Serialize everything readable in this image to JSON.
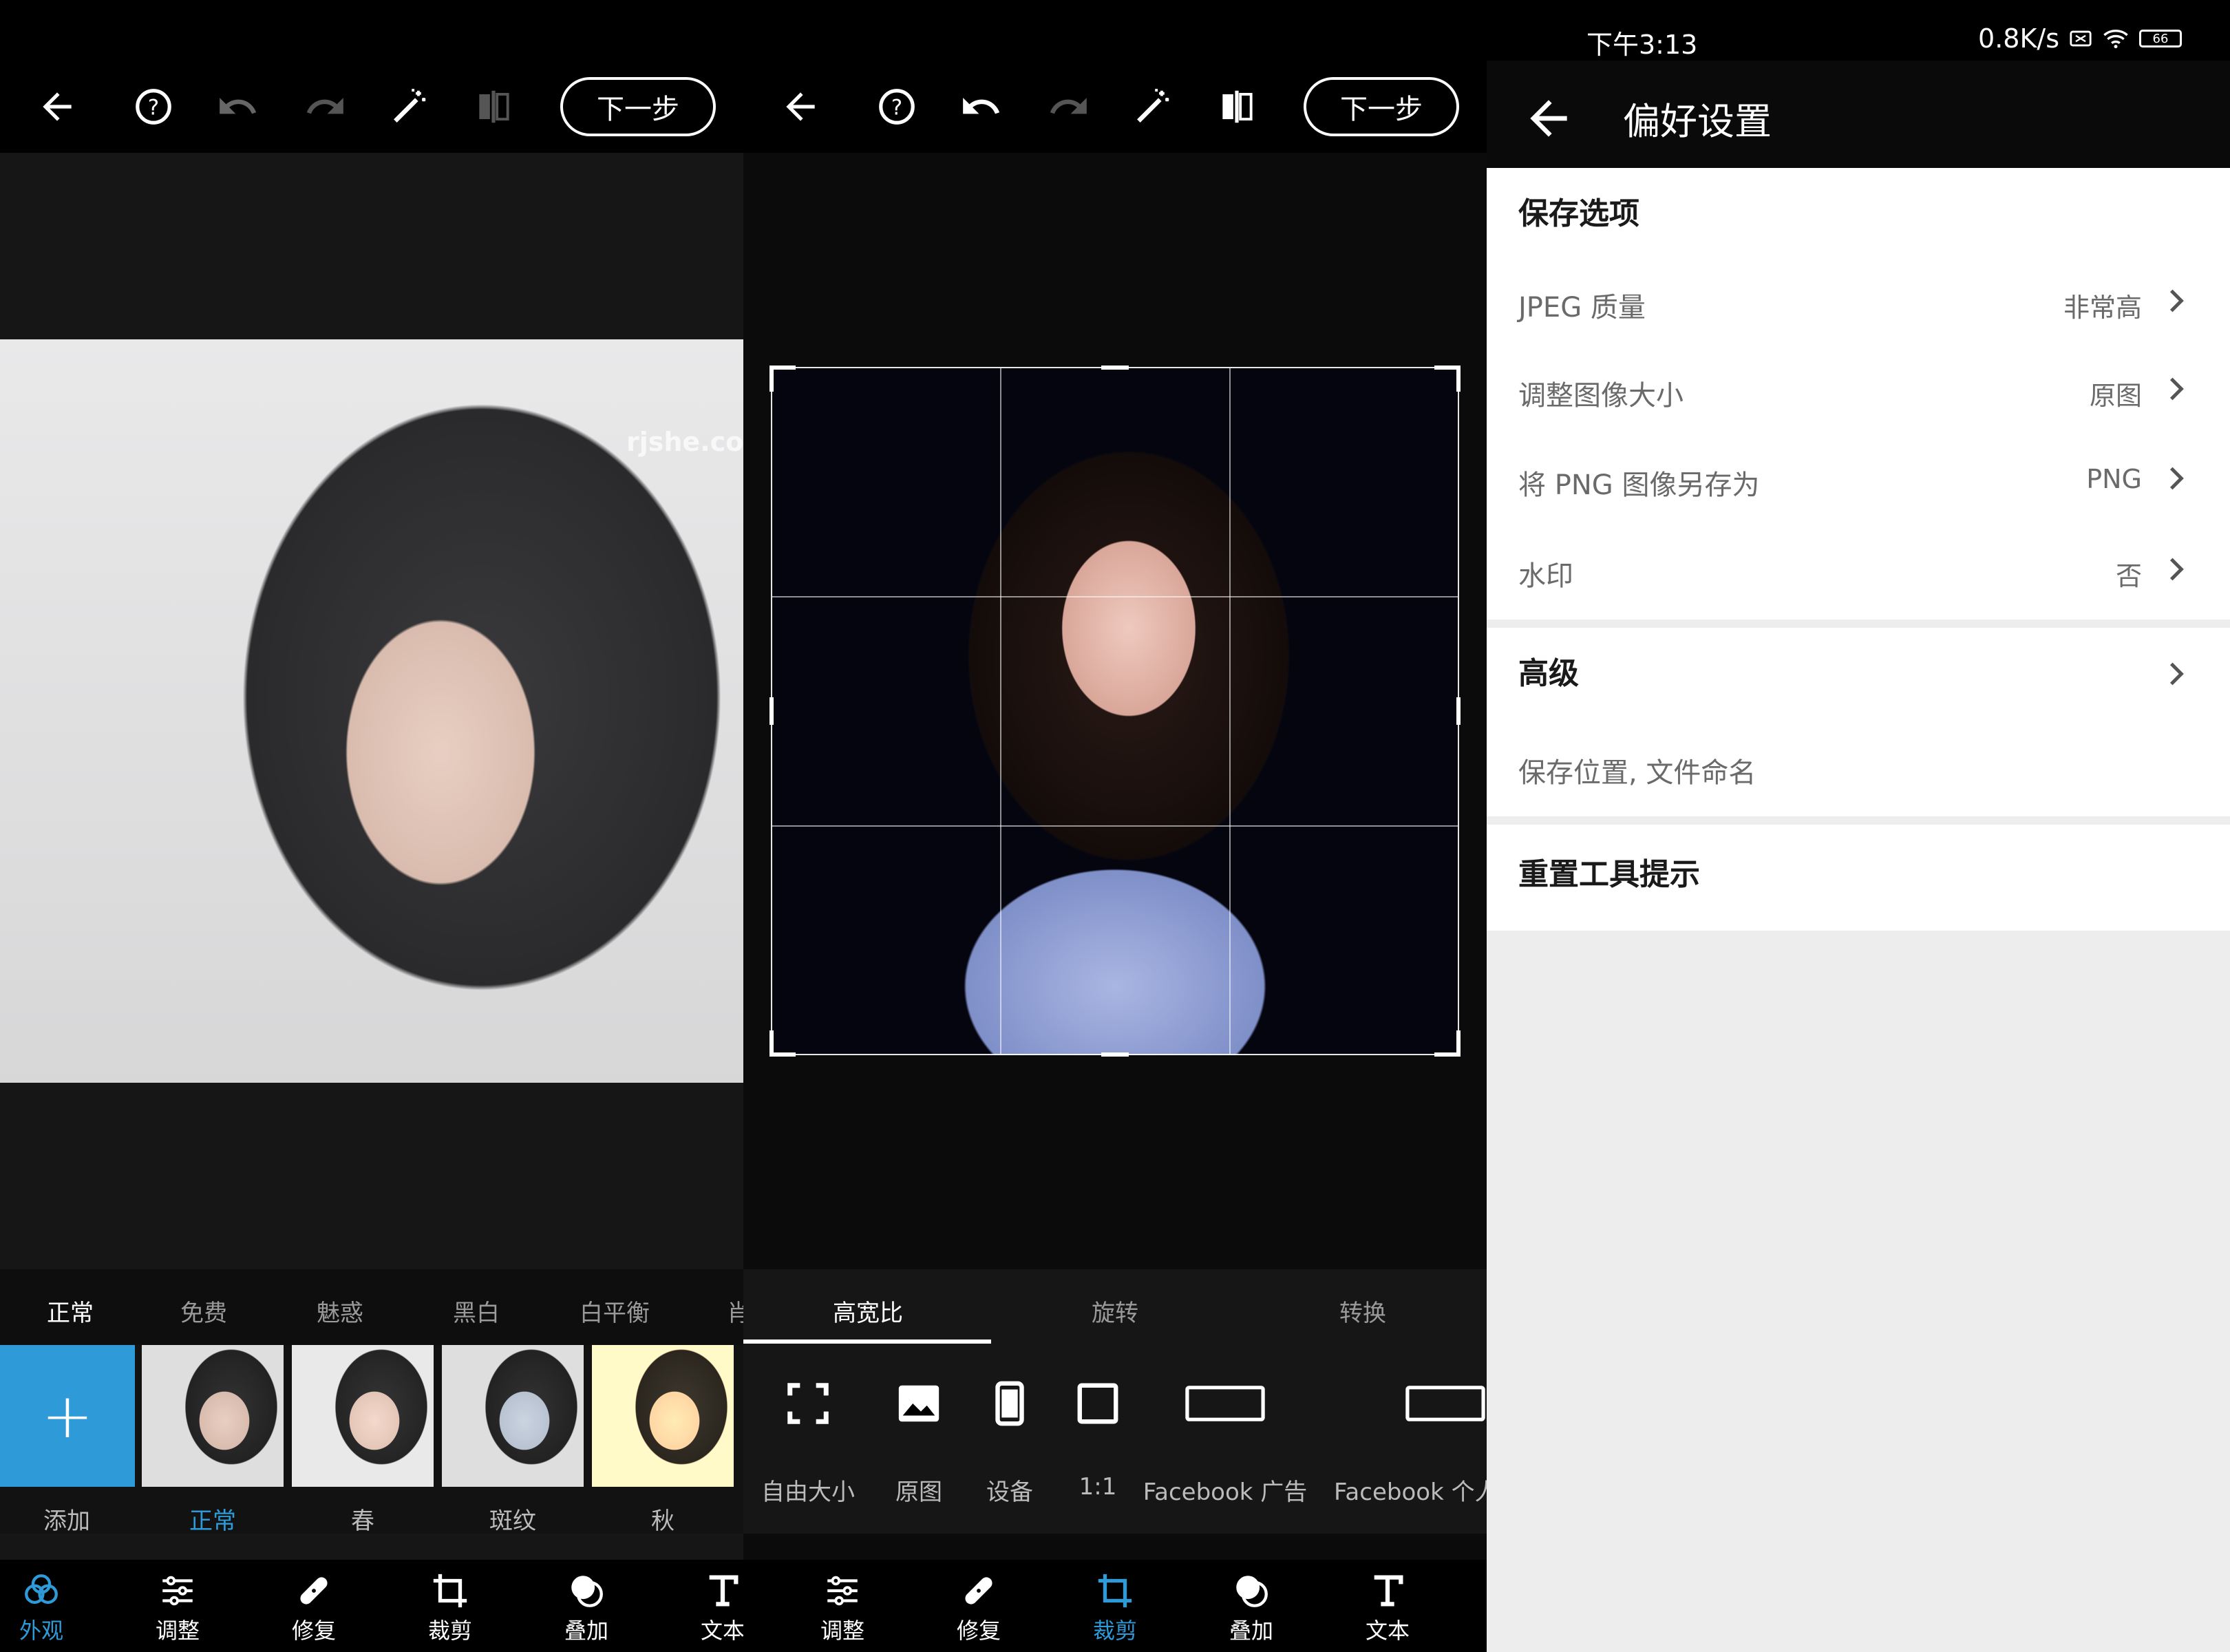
{
  "editor1": {
    "next_label": "下一步",
    "watermark": "rjshe.com",
    "filter_tabs": [
      "正常",
      "免费",
      "魅惑",
      "黑白",
      "白平衡",
      "肖"
    ],
    "add_label": "添加",
    "thumb_labels": [
      "正常",
      "春",
      "斑纹",
      "秋"
    ],
    "nav": [
      "外观",
      "调整",
      "修复",
      "裁剪",
      "叠加",
      "文本"
    ]
  },
  "editor2": {
    "next_label": "下一步",
    "crop_tabs": [
      "高宽比",
      "旋转",
      "转换"
    ],
    "aspects": [
      "自由大小",
      "原图",
      "设备",
      "1:1",
      "Facebook 广告",
      "Facebook 个人"
    ],
    "nav": [
      "调整",
      "修复",
      "裁剪",
      "叠加",
      "文本"
    ]
  },
  "settings": {
    "status_time": "下午3:13",
    "status_speed": "0.8K/s",
    "battery": "66",
    "title": "偏好设置",
    "save_section": "保存选项",
    "rows": [
      {
        "label": "JPEG 质量",
        "value": "非常高"
      },
      {
        "label": "调整图像大小",
        "value": "原图"
      },
      {
        "label": "将 PNG 图像另存为",
        "value": "PNG"
      },
      {
        "label": "水印",
        "value": "否"
      }
    ],
    "advanced": "高级",
    "advanced_sub": "保存位置, 文件命名",
    "reset_tips": "重置工具提示"
  },
  "colors": {
    "accent": "#2e9ad8"
  }
}
